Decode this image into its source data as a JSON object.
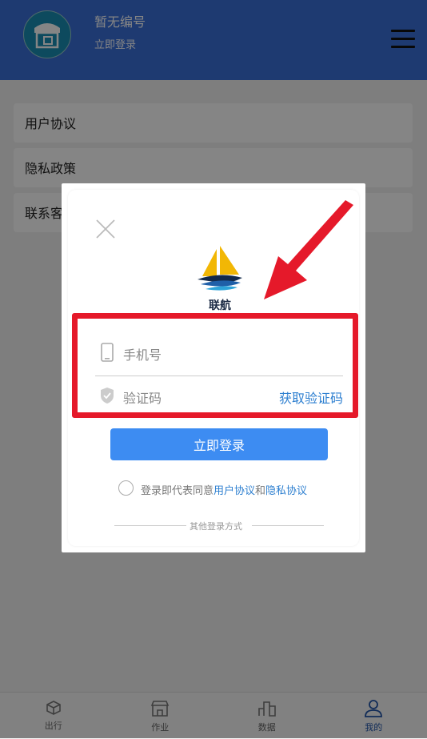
{
  "header": {
    "title": "暂无编号",
    "subtitle": "立即登录"
  },
  "menu": {
    "items": [
      {
        "label": "用户协议"
      },
      {
        "label": "隐私政策"
      },
      {
        "label": "联系客"
      }
    ]
  },
  "tabbar": {
    "tabs": [
      {
        "label": "出行",
        "icon": "cube-icon"
      },
      {
        "label": "作业",
        "icon": "store-icon"
      },
      {
        "label": "数据",
        "icon": "bar-chart-icon"
      },
      {
        "label": "我的",
        "icon": "user-icon"
      }
    ]
  },
  "modal": {
    "logo_text": "联航",
    "phone_placeholder": "手机号",
    "code_placeholder": "验证码",
    "get_code_label": "获取验证码",
    "login_button": "立即登录",
    "agreement_prefix": "登录即代表同意",
    "agreement_link1": "用户协议",
    "agreement_and": "和",
    "agreement_link2": "隐私协议",
    "other_login": "其他登录方式"
  },
  "colors": {
    "header": "#3a6fd8",
    "accent": "#3d8cf2",
    "link": "#2d7fd0",
    "highlight": "#e5192a"
  }
}
